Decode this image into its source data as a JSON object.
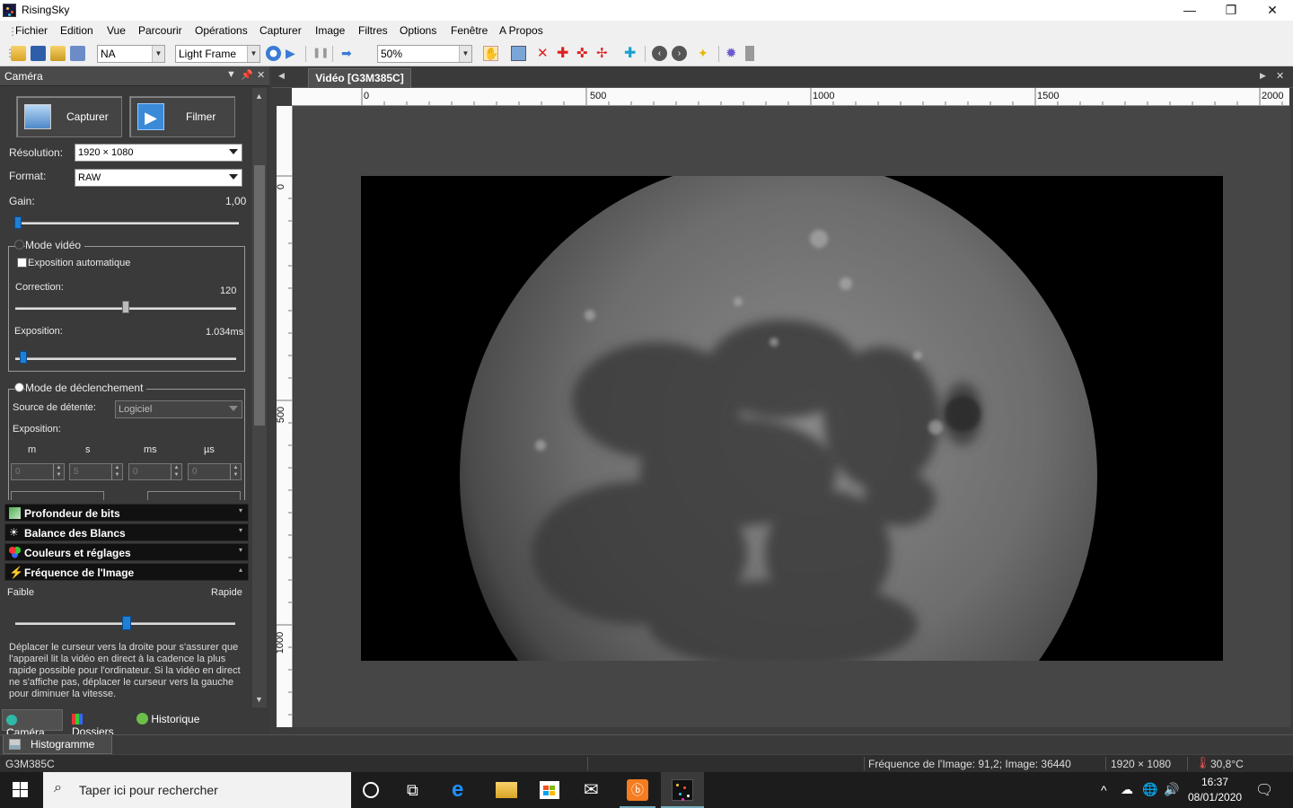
{
  "window": {
    "title": "RisingSky",
    "minimize_label": "—",
    "maximize_label": "❐",
    "close_label": "✕"
  },
  "menu": [
    "Fichier",
    "Edition",
    "Vue",
    "Parcourir",
    "Opérations",
    "Capturer",
    "Image",
    "Filtres",
    "Options",
    "Fenêtre",
    "A Propos"
  ],
  "toolbar": {
    "combo_na": "NA",
    "combo_frame": "Light Frame",
    "combo_zoom": "50%"
  },
  "panel": {
    "title": "Caméra",
    "capture_label": "Capturer",
    "film_label": "Filmer",
    "resolution_label": "Résolution:",
    "resolution_value": "1920 × 1080",
    "format_label": "Format:",
    "format_value": "RAW",
    "gain_label": "Gain:",
    "gain_value": "1,00",
    "gain_fraction": 0.0,
    "video_mode_label": "Mode vidéo",
    "auto_exposure_label": "Exposition automatique",
    "correction_label": "Correction:",
    "correction_value": "120",
    "correction_fraction": 0.5,
    "exposure_label": "Exposition:",
    "exposure_value": "1.034ms",
    "exposure_fraction": 0.02,
    "trigger_mode_label": "Mode de déclenchement",
    "trigger_source_label": "Source de détente:",
    "trigger_source_value": "Logiciel",
    "trigger_exposure_label": "Exposition:",
    "units": [
      "m",
      "s",
      "ms",
      "µs"
    ],
    "unit_values": [
      "0",
      "5",
      "0",
      "0"
    ],
    "sections": [
      "Profondeur de bits",
      "Balance des Blancs",
      "Couleurs et réglages",
      "Fréquence de l'Image"
    ],
    "freq_low": "Faible",
    "freq_high": "Rapide",
    "freq_fraction": 0.5,
    "freq_help": "Déplacer le curseur vers la droite pour s'assurer que l'appareil lit la vidéo en direct à la cadence la plus rapide possible pour l'ordinateur. Si la vidéo en direct ne s'affiche pas, déplacer le curseur vers la gauche pour diminuer la vitesse.",
    "bottom_tabs": [
      "Caméra",
      "Dossiers",
      "Historique"
    ],
    "histogram_tab": "Histogramme"
  },
  "document": {
    "tab_title": "Vidéo [G3M385C]",
    "hruler_labels": [
      "0",
      "500",
      "1000",
      "1500",
      "2000"
    ],
    "vruler_labels": [
      "0",
      "500",
      "1000"
    ]
  },
  "status": {
    "camera": "G3M385C",
    "frame_rate": "Fréquence de l'Image: 91,2; Image: 36440",
    "resolution": "1920 × 1080",
    "temperature": "30,8°C"
  },
  "taskbar": {
    "search_placeholder": "Taper ici pour rechercher",
    "time": "16:37",
    "date": "08/01/2020"
  },
  "colors": {
    "accent_blue": "#1f7fd6",
    "panel_bg": "#3a3a3a",
    "canvas_bg": "#464646"
  }
}
